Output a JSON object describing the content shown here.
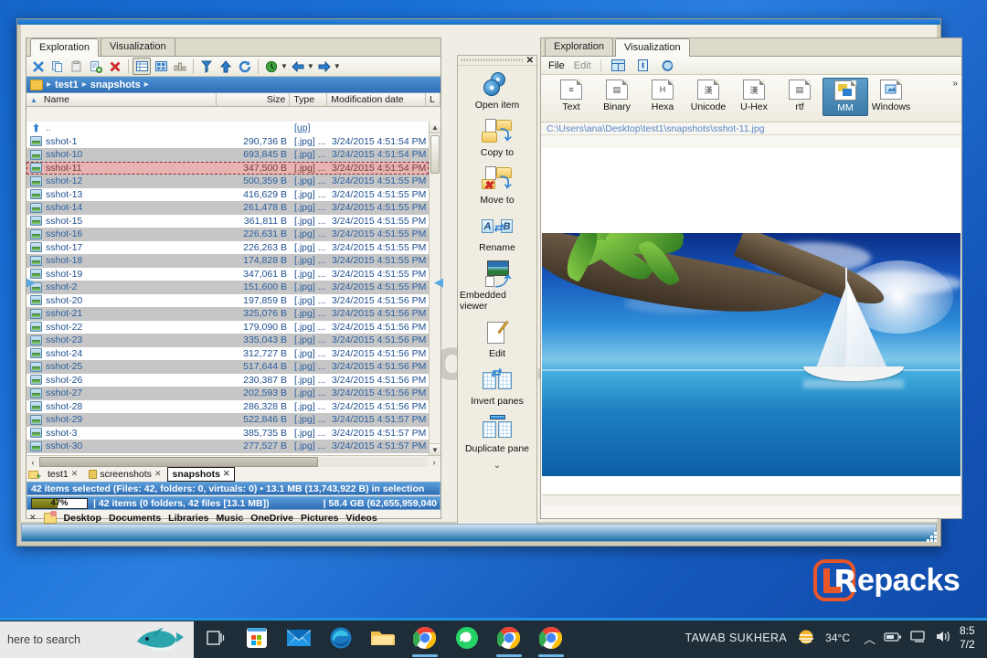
{
  "window": {
    "left_pane": {
      "tabs": [
        {
          "label": "Exploration",
          "active": true
        },
        {
          "label": "Visualization",
          "active": false
        }
      ],
      "toolbar_icons": [
        "cut-icon",
        "copy-icon",
        "paste-icon",
        "properties-icon",
        "delete-icon",
        "details-view-icon",
        "thumbnails-view-icon",
        "list-view-icon",
        "filter-icon",
        "up-level-icon",
        "refresh-icon",
        "history-icon",
        "back-icon",
        "forward-icon"
      ],
      "breadcrumb": {
        "root_icon": "folder-icon",
        "crumbs": [
          "test1",
          "snapshots"
        ]
      },
      "columns": [
        "Name",
        "Size",
        "Type",
        "Modification date",
        "L"
      ],
      "up_row": {
        "name": "..",
        "type": "[up]"
      },
      "files": [
        {
          "name": "sshot-1",
          "size": "290,736 B",
          "type": "[.jpg] ...",
          "date": "3/24/2015 4:51:54 PM",
          "state": "odd"
        },
        {
          "name": "sshot-10",
          "size": "693,845 B",
          "type": "[.jpg] ...",
          "date": "3/24/2015 4:51:54 PM",
          "state": "even"
        },
        {
          "name": "sshot-11",
          "size": "347,500 B",
          "type": "[.jpg] ...",
          "date": "3/24/2015 4:51:54 PM",
          "state": "sel"
        },
        {
          "name": "sshot-12",
          "size": "500,359 B",
          "type": "[.jpg] ...",
          "date": "3/24/2015 4:51:55 PM",
          "state": "even"
        },
        {
          "name": "sshot-13",
          "size": "416,629 B",
          "type": "[.jpg] ...",
          "date": "3/24/2015 4:51:55 PM",
          "state": "odd"
        },
        {
          "name": "sshot-14",
          "size": "261,478 B",
          "type": "[.jpg] ...",
          "date": "3/24/2015 4:51:55 PM",
          "state": "even"
        },
        {
          "name": "sshot-15",
          "size": "361,811 B",
          "type": "[.jpg] ...",
          "date": "3/24/2015 4:51:55 PM",
          "state": "odd"
        },
        {
          "name": "sshot-16",
          "size": "226,631 B",
          "type": "[.jpg] ...",
          "date": "3/24/2015 4:51:55 PM",
          "state": "even"
        },
        {
          "name": "sshot-17",
          "size": "226,263 B",
          "type": "[.jpg] ...",
          "date": "3/24/2015 4:51:55 PM",
          "state": "odd"
        },
        {
          "name": "sshot-18",
          "size": "174,828 B",
          "type": "[.jpg] ...",
          "date": "3/24/2015 4:51:55 PM",
          "state": "even"
        },
        {
          "name": "sshot-19",
          "size": "347,061 B",
          "type": "[.jpg] ...",
          "date": "3/24/2015 4:51:55 PM",
          "state": "odd"
        },
        {
          "name": "sshot-2",
          "size": "151,600 B",
          "type": "[.jpg] ...",
          "date": "3/24/2015 4:51:55 PM",
          "state": "even"
        },
        {
          "name": "sshot-20",
          "size": "197,859 B",
          "type": "[.jpg] ...",
          "date": "3/24/2015 4:51:56 PM",
          "state": "odd"
        },
        {
          "name": "sshot-21",
          "size": "325,076 B",
          "type": "[.jpg] ...",
          "date": "3/24/2015 4:51:56 PM",
          "state": "even"
        },
        {
          "name": "sshot-22",
          "size": "179,090 B",
          "type": "[.jpg] ...",
          "date": "3/24/2015 4:51:56 PM",
          "state": "odd"
        },
        {
          "name": "sshot-23",
          "size": "335,043 B",
          "type": "[.jpg] ...",
          "date": "3/24/2015 4:51:56 PM",
          "state": "even"
        },
        {
          "name": "sshot-24",
          "size": "312,727 B",
          "type": "[.jpg] ...",
          "date": "3/24/2015 4:51:56 PM",
          "state": "odd"
        },
        {
          "name": "sshot-25",
          "size": "517,644 B",
          "type": "[.jpg] ...",
          "date": "3/24/2015 4:51:56 PM",
          "state": "even"
        },
        {
          "name": "sshot-26",
          "size": "230,387 B",
          "type": "[.jpg] ...",
          "date": "3/24/2015 4:51:56 PM",
          "state": "odd"
        },
        {
          "name": "sshot-27",
          "size": "202,593 B",
          "type": "[.jpg] ...",
          "date": "3/24/2015 4:51:56 PM",
          "state": "even"
        },
        {
          "name": "sshot-28",
          "size": "286,328 B",
          "type": "[.jpg] ...",
          "date": "3/24/2015 4:51:56 PM",
          "state": "odd"
        },
        {
          "name": "sshot-29",
          "size": "522,846 B",
          "type": "[.jpg] ...",
          "date": "3/24/2015 4:51:57 PM",
          "state": "even"
        },
        {
          "name": "sshot-3",
          "size": "385,735 B",
          "type": "[.jpg] ...",
          "date": "3/24/2015 4:51:57 PM",
          "state": "odd"
        },
        {
          "name": "sshot-30",
          "size": "277,527 B",
          "type": "[.jpg] ...",
          "date": "3/24/2015 4:51:57 PM",
          "state": "even"
        }
      ],
      "folder_tabs": [
        {
          "label": "test1",
          "active": false,
          "icon": "none"
        },
        {
          "label": "screenshots",
          "active": false,
          "icon": "lock-icon"
        },
        {
          "label": "snapshots",
          "active": true,
          "icon": "none"
        }
      ],
      "status_selection": "42 items selected (Files: 42, folders: 0, virtuals: 0) • 13.1 MB (13,743,922 B) in selection",
      "status_percent": "47%",
      "status_items": "| 42 items (0 folders, 42 files [13.1 MB])",
      "status_free": "| 58.4 GB (62,655,959,040",
      "quick_links": [
        "Desktop",
        "Documents",
        "Libraries",
        "Music",
        "OneDrive",
        "Pictures",
        "Videos"
      ]
    },
    "command_panel": {
      "close_label": "✕",
      "commands": [
        {
          "label": "Open item",
          "icon": "gears-icon"
        },
        {
          "label": "Copy to",
          "icon": "copy-to-folder-icon"
        },
        {
          "label": "Move to",
          "icon": "move-to-folder-icon"
        },
        {
          "label": "Rename",
          "icon": "rename-ab-icon"
        },
        {
          "label": "Embedded viewer",
          "icon": "embedded-viewer-icon"
        },
        {
          "label": "Edit",
          "icon": "edit-pencil-icon"
        },
        {
          "label": "Invert panes",
          "icon": "invert-panes-icon"
        },
        {
          "label": "Duplicate pane",
          "icon": "duplicate-pane-icon"
        }
      ],
      "more_chevron": "⌄"
    },
    "right_pane": {
      "tabs": [
        {
          "label": "Exploration",
          "active": false
        },
        {
          "label": "Visualization",
          "active": true
        }
      ],
      "menu": [
        "File",
        "Edit"
      ],
      "menu_icons": [
        "split-view-icon",
        "info-icon",
        "reload-icon"
      ],
      "view_buttons": [
        {
          "label": "Text",
          "selected": false
        },
        {
          "label": "Binary",
          "selected": false
        },
        {
          "label": "Hexa",
          "selected": false
        },
        {
          "label": "Unicode",
          "selected": false
        },
        {
          "label": "U-Hex",
          "selected": false
        },
        {
          "label": "rtf",
          "selected": false
        },
        {
          "label": "MM",
          "selected": true
        },
        {
          "label": "Windows",
          "selected": false
        }
      ],
      "overflow_chevron": "»",
      "path": "C:\\Users\\ana\\Desktop\\test1\\snapshots\\sshot-11.jpg",
      "preview_alt": "beach-palm-sailboat-photo"
    }
  },
  "watermark": "Repacks.com.ru",
  "desktop_logo": {
    "mark": "L",
    "r": "R",
    "text": "epacks"
  },
  "taskbar": {
    "search_placeholder": "here to search",
    "apps": [
      {
        "name": "task-view-icon",
        "active": false
      },
      {
        "name": "microsoft-store-icon",
        "active": false
      },
      {
        "name": "mail-icon",
        "active": false
      },
      {
        "name": "edge-icon",
        "active": false
      },
      {
        "name": "file-explorer-icon",
        "active": false
      },
      {
        "name": "chrome-icon",
        "active": true
      },
      {
        "name": "whatsapp-icon",
        "active": false
      },
      {
        "name": "chrome-icon",
        "active": true
      },
      {
        "name": "chrome-icon",
        "active": true
      }
    ],
    "user": "TAWAB SUKHERA",
    "weather": "34°C",
    "weather_icon": "sun-cloud-icon",
    "tray_icons": [
      "show-hidden-icons-chevron",
      "battery-icon",
      "network-icon",
      "volume-icon"
    ],
    "clock_time": "8:5",
    "clock_date": "7/2"
  },
  "colors": {
    "accent_blue": "#1f8fe0",
    "status_blue": "#2f6db3",
    "selection_red": "#e7b3b3",
    "logo_orange": "#e8562a",
    "desktop_blue": "#1558bb"
  }
}
